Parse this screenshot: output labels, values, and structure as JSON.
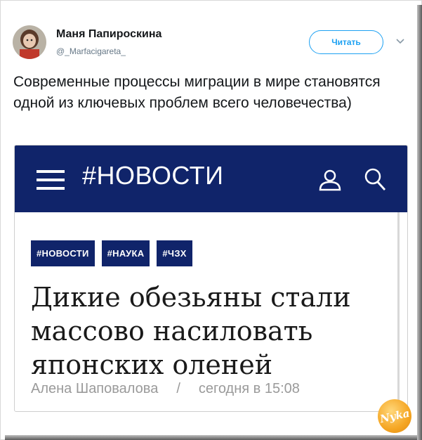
{
  "tweet": {
    "author_name": "Маня Папироскина",
    "author_handle": "@_Marfacigareta_",
    "follow_label": "Читать",
    "text": "Современные процессы миграции в мире становятся одной из ключевых проблем всего человечества)"
  },
  "card": {
    "nav_title": "#НОВОСТИ",
    "tags": [
      "#НОВОСТИ",
      "#НАУКА",
      "#ЧЗХ"
    ],
    "headline": "Дикие обезьяны стали массово насиловать японских оленей",
    "author": "Алена Шаповалова",
    "separator": "/",
    "date": "сегодня в 15:08"
  },
  "watermark": {
    "text": "Nyka"
  },
  "colors": {
    "navy": "#10246a",
    "twitter_blue": "#1da1f2",
    "meta_grey": "#9a9a9a"
  },
  "icons": {
    "menu": "hamburger-icon",
    "user": "user-icon",
    "search": "search-icon",
    "caret": "chevron-down-icon"
  }
}
